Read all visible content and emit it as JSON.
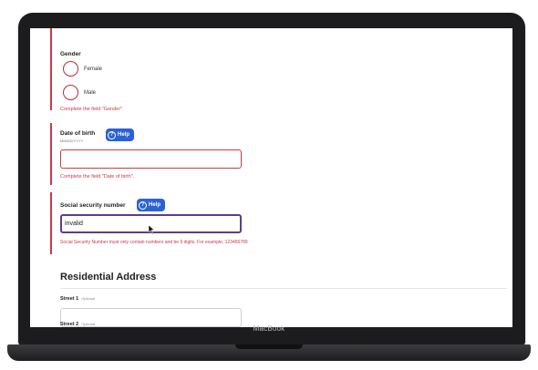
{
  "device": {
    "brand": "MacBook"
  },
  "gender": {
    "label": "Gender",
    "options": [
      "Female",
      "Male"
    ],
    "error": "Complete the field \"Gender\"."
  },
  "dob": {
    "label": "Date of birth",
    "hint": "MM/DD/YYYY",
    "help": "Help",
    "value": "",
    "error": "Complete the field \"Date of birth\"."
  },
  "ssn": {
    "label": "Social security number",
    "help": "Help",
    "value": "invalid",
    "error": "Social Security Number must only contain numbers and be 9 digits. For example, 123456789"
  },
  "address": {
    "title": "Residential Address",
    "street1_label": "Street 1",
    "street1_optional": "Optional",
    "street2_label": "Street 2",
    "street2_optional": "Optional"
  }
}
